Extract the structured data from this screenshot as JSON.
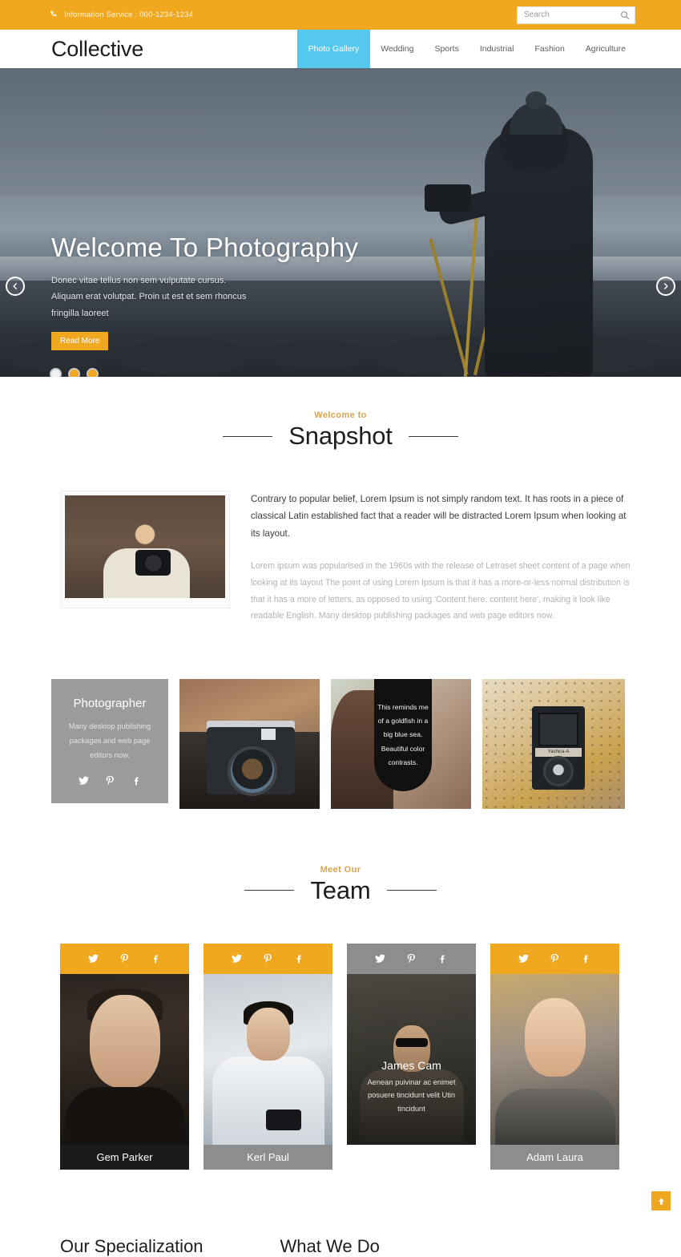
{
  "topbar": {
    "phone_icon": "phone-icon",
    "info_text": "Information Service : 000-1234-1234",
    "search_placeholder": "Search",
    "search_value": "",
    "search_icon": "search-icon",
    "bg_color": "#f0a81e"
  },
  "header": {
    "logo": "Collective",
    "nav": [
      {
        "label": "Photo Gallery",
        "active": true
      },
      {
        "label": "Wedding",
        "active": false
      },
      {
        "label": "Sports",
        "active": false
      },
      {
        "label": "Industrial",
        "active": false
      },
      {
        "label": "Fashion",
        "active": false
      },
      {
        "label": "Agriculture",
        "active": false
      }
    ],
    "active_color": "#54c8ef"
  },
  "hero": {
    "title": "Welcome To Photography",
    "subtitle": "Donec vitae tellus non sem vulputate cursus. Aliquam erat volutpat. Proin ut est et sem rhoncus fringilla laoreet",
    "button_label": "Read More",
    "prev_icon": "chevron-left-icon",
    "next_icon": "chevron-right-icon",
    "dots": [
      {
        "active": true
      },
      {
        "active": false
      },
      {
        "active": false
      }
    ]
  },
  "snapshot": {
    "kicker": "Welcome to",
    "title": "Snapshot",
    "image_alt": "photographer-with-camera",
    "paragraph_primary": "Contrary to popular belief, Lorem Ipsum is not simply random text. It has roots in a piece of classical Latin established fact that a reader will be distracted Lorem Ipsum when looking at its layout.",
    "paragraph_secondary": "Lorem ipsum was popularised in the 1960s with the release of Letraset sheet content of a page when looking at its layout The point of using Lorem Ipsum is that it has a more-or-less normal distribution is that it has a more of letters, as opposed to using 'Content here, content here', making it look like readable English. Many desktop publishing packages and web page editors now."
  },
  "gallery": {
    "card": {
      "title": "Photographer",
      "text": "Many desktop publishing packages and web page editors now.",
      "social": [
        "twitter-icon",
        "pinterest-icon",
        "facebook-icon"
      ],
      "bg_color": "#9b9b9b"
    },
    "tile2_alt": "vintage-camera-in-hands",
    "tile3_caption": "This reminds me of a goldfish in a big blue sea. Beautiful color contrasts.",
    "tile3_alt": "woman-portrait",
    "tile4_alt": "yashica-a-twin-lens-camera",
    "tile4_label": "Yashica-A"
  },
  "team": {
    "kicker": "Meet Our",
    "title": "Team",
    "social": [
      "twitter-icon",
      "pinterest-icon",
      "facebook-icon"
    ],
    "members": [
      {
        "name": "Gem Parker",
        "bar": "orange",
        "name_bg": "dark",
        "desc": "",
        "show_overlay": false
      },
      {
        "name": "Kerl Paul",
        "bar": "orange",
        "name_bg": "gray",
        "desc": "",
        "show_overlay": false
      },
      {
        "name": "James Cam",
        "bar": "gray",
        "name_bg": "trans",
        "desc": "Aenean puivinar ac enimet posuere tincidunt velit Utin tincidunt",
        "show_overlay": true
      },
      {
        "name": "Adam Laura",
        "bar": "orange",
        "name_bg": "gray",
        "desc": "",
        "show_overlay": false
      }
    ]
  },
  "bottom": {
    "heading_left": "Our Specialization",
    "heading_right": "What We Do"
  },
  "scroll_top": {
    "icon": "arrow-up-icon",
    "bg_color": "#f0a81e"
  }
}
